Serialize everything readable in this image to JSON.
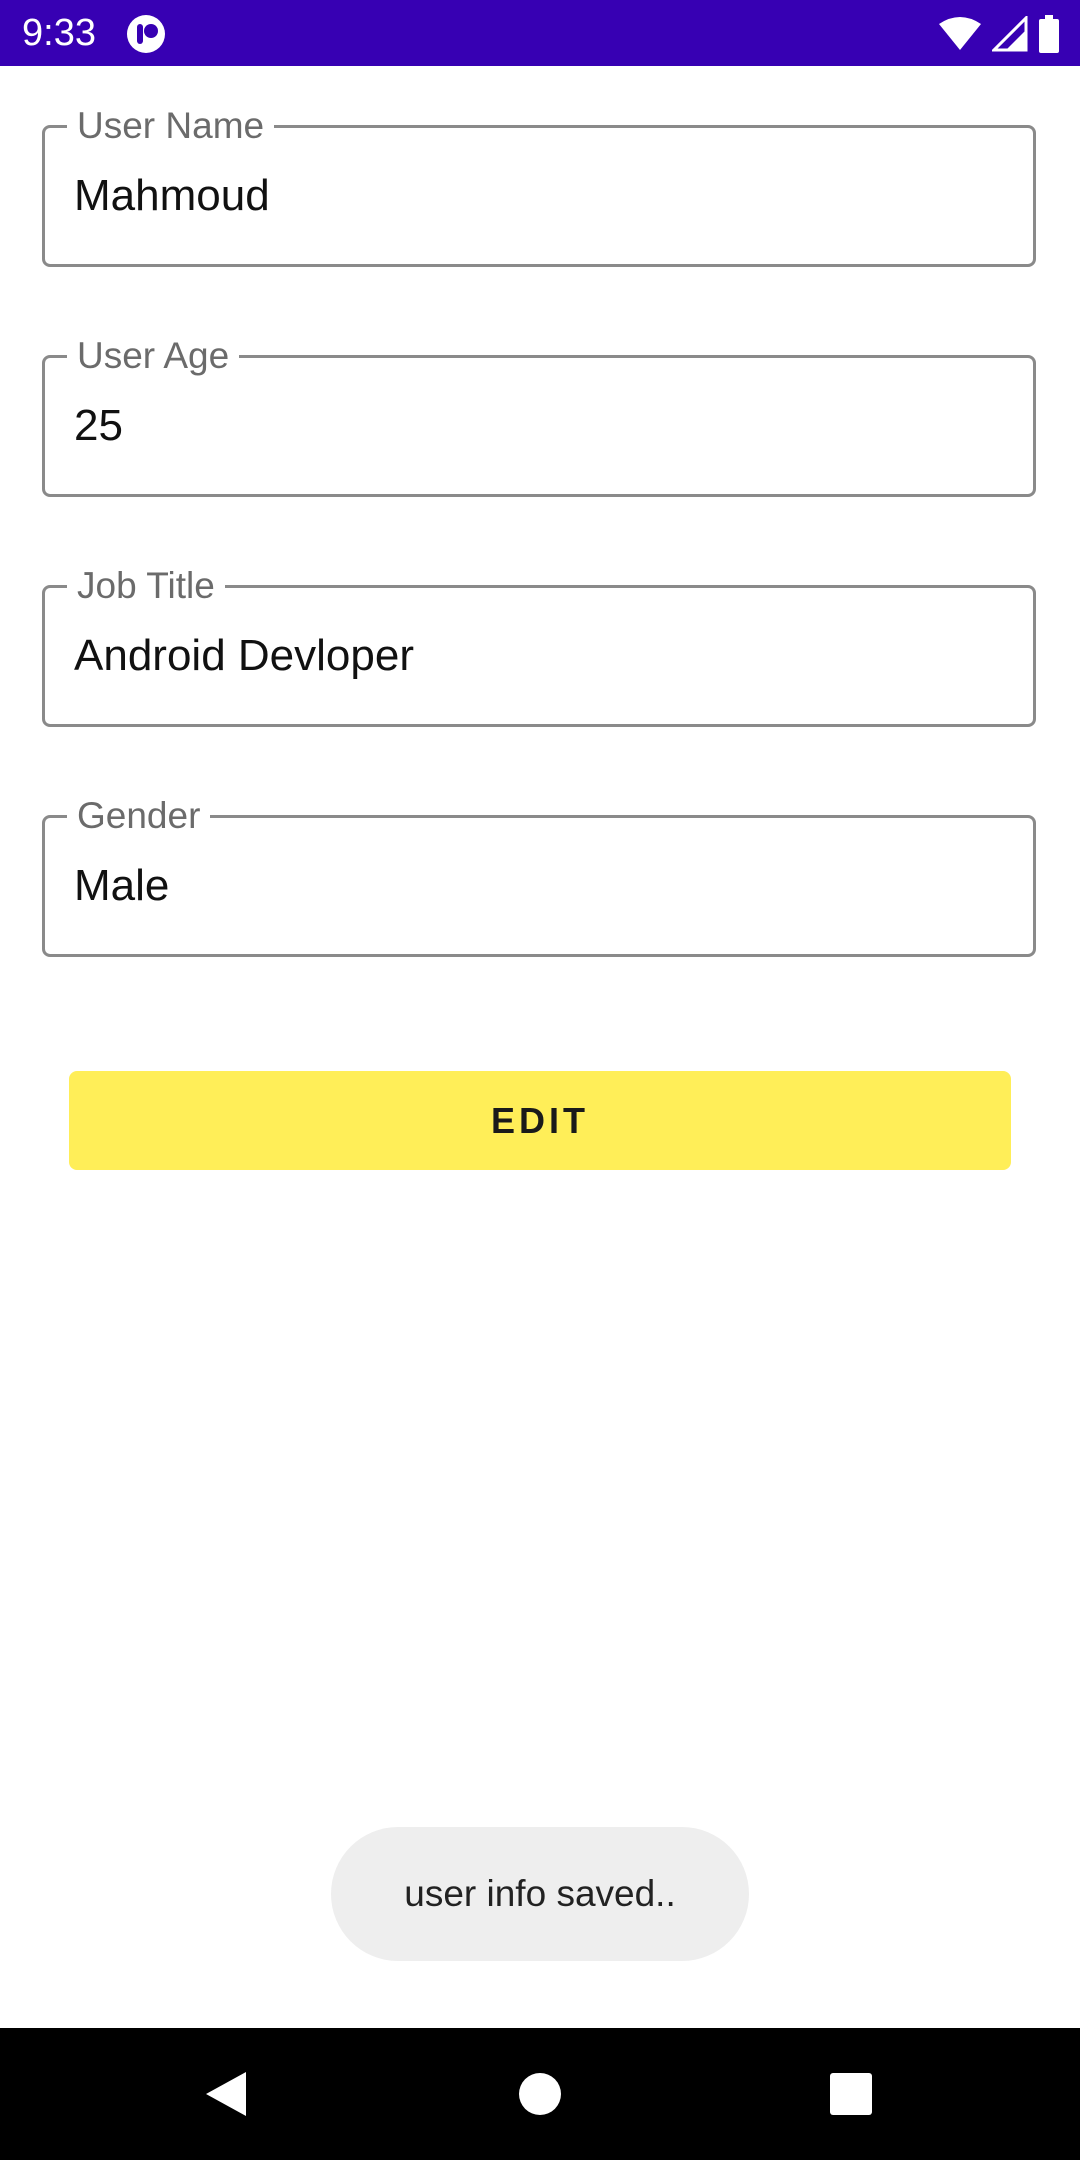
{
  "status_bar": {
    "time": "9:33",
    "bg_color": "#3700b3",
    "icons": [
      "app-notification-icon",
      "wifi-icon",
      "signal-icon",
      "battery-icon"
    ]
  },
  "form": {
    "fields": [
      {
        "label": "User Name",
        "value": "Mahmoud"
      },
      {
        "label": "User Age",
        "value": "25"
      },
      {
        "label": "Job Title",
        "value": "Android Devloper"
      },
      {
        "label": "Gender",
        "value": "Male"
      }
    ],
    "edit_button_label": "EDIT",
    "edit_button_color": "#ffee58"
  },
  "toast": {
    "message": "user info saved.."
  },
  "nav_bar": {
    "icons": [
      "back-icon",
      "home-icon",
      "recents-icon"
    ]
  }
}
